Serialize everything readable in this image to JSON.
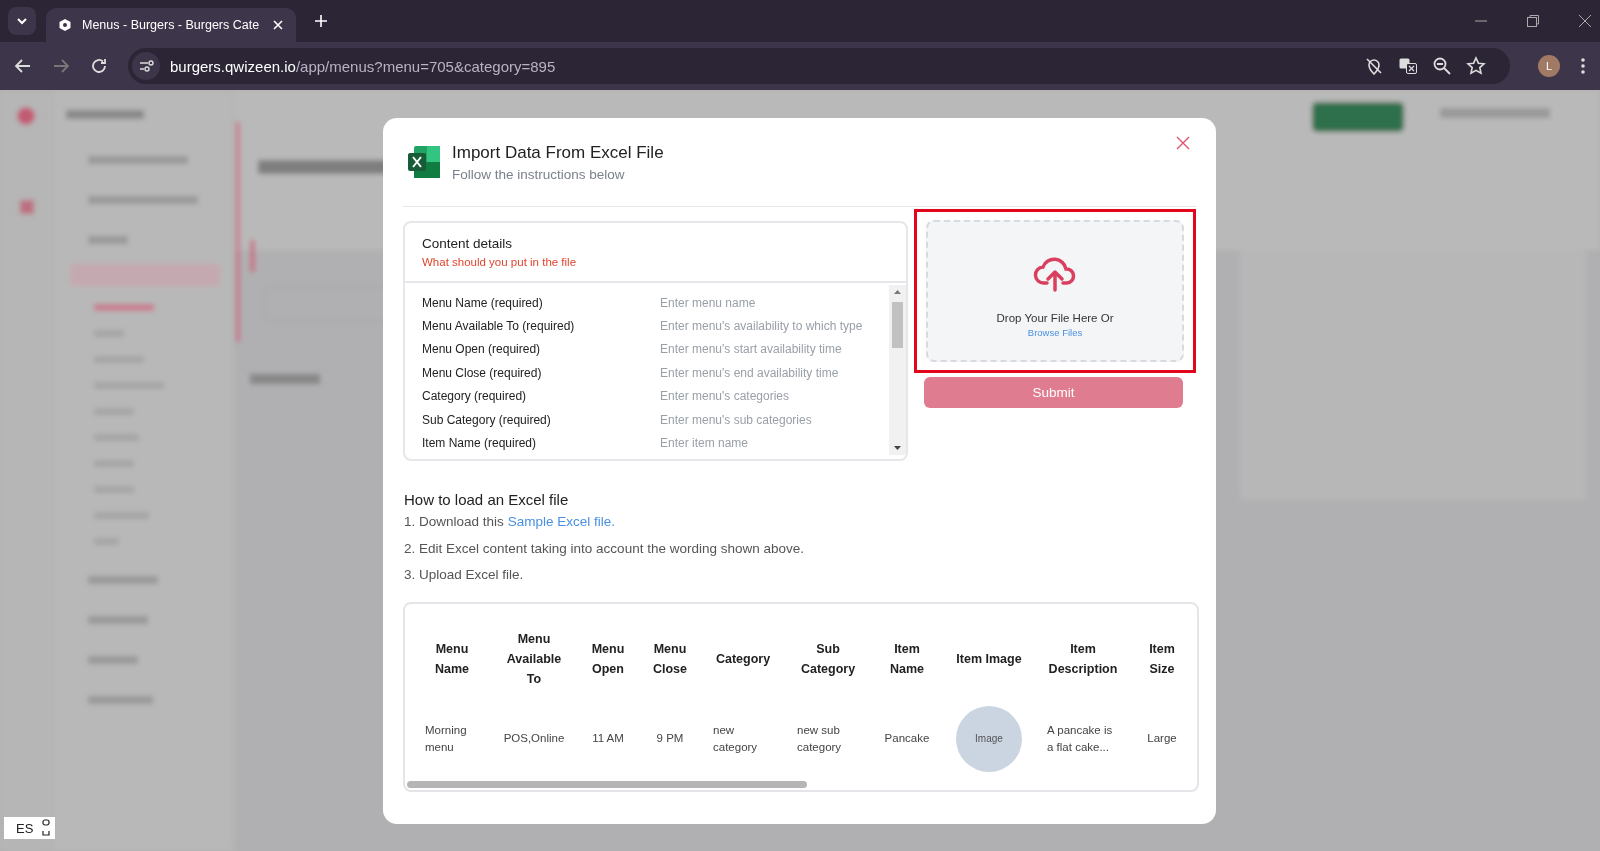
{
  "browser": {
    "tab_title": "Menus - Burgers - Burgers Cate",
    "url_host": "burgers.qwizeen.io",
    "url_path": "/app/menus?menu=705&category=895",
    "profile_initial": "L"
  },
  "dialog": {
    "title": "Import Data From Excel File",
    "subtitle": "Follow the instructions below",
    "content_details": {
      "title": "Content details",
      "subtitle": "What should you put in the file",
      "rows": [
        {
          "field": "Menu Name (required)",
          "hint": "Enter menu name"
        },
        {
          "field": "Menu Available To (required)",
          "hint": "Enter menu's availability to which type"
        },
        {
          "field": "Menu Open (required)",
          "hint": "Enter menu's start availability time"
        },
        {
          "field": "Menu Close (required)",
          "hint": "Enter menu's end availability time"
        },
        {
          "field": "Category (required)",
          "hint": "Enter menu's categories"
        },
        {
          "field": "Sub Category (required)",
          "hint": "Enter menu's sub categories"
        },
        {
          "field": "Item Name (required)",
          "hint": "Enter item name"
        }
      ]
    },
    "dropzone": {
      "text": "Drop Your File Here Or",
      "link": "Browse Files",
      "highlighted": true
    },
    "submit": "Submit",
    "howto": {
      "title": "How to load an Excel file",
      "steps": [
        {
          "number": "1.",
          "text": "Download this",
          "link": "Sample Excel file."
        },
        {
          "number": "2.",
          "text": "Edit Excel content taking into account the wording shown above."
        },
        {
          "number": "3.",
          "text": "Upload Excel file."
        }
      ]
    },
    "sample_table": {
      "columns": [
        "Menu Name",
        "Menu Available To",
        "Menu Open",
        "Menu Close",
        "Category",
        "Sub Category",
        "Item Name",
        "Item Image",
        "Item Description",
        "Item Size"
      ],
      "rows": [
        [
          {
            "kind": "text",
            "text": "Morning menu"
          },
          {
            "kind": "text",
            "text": "POS,Online"
          },
          {
            "kind": "text",
            "text": "11 AM"
          },
          {
            "kind": "text",
            "text": "9 PM"
          },
          {
            "kind": "text",
            "text": "new category"
          },
          {
            "kind": "text",
            "text": "new sub category"
          },
          {
            "kind": "text",
            "text": "Pancake"
          },
          {
            "kind": "image",
            "text": "Image"
          },
          {
            "kind": "text",
            "text": "A pancake is a flat cake..."
          },
          {
            "kind": "text",
            "text": "Large"
          }
        ]
      ]
    }
  },
  "language_badge": "ES"
}
